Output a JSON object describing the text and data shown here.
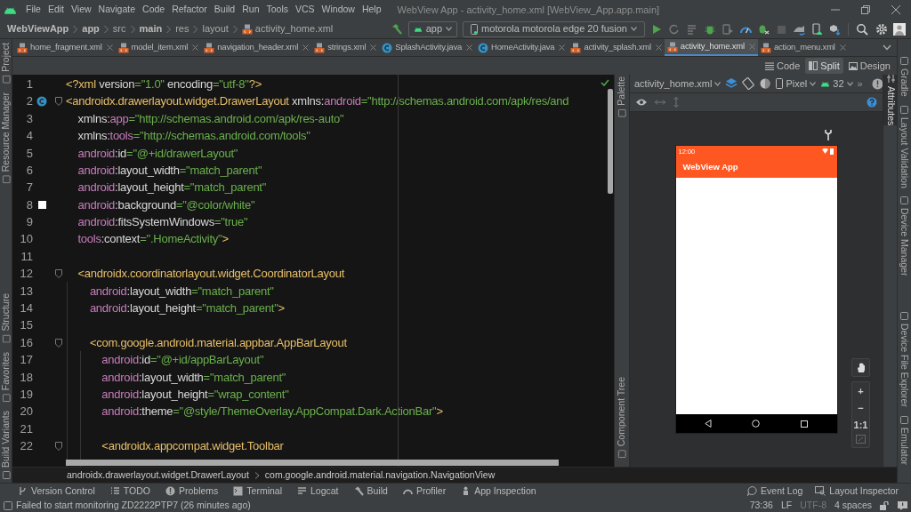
{
  "menu_bar": {
    "items": [
      "File",
      "Edit",
      "View",
      "Navigate",
      "Code",
      "Refactor",
      "Build",
      "Run",
      "Tools",
      "VCS",
      "Window",
      "Help"
    ],
    "title": "WebView App - activity_home.xml [WebView_App.app.main]"
  },
  "nav_bar": {
    "breadcrumbs": [
      {
        "label": "WebViewApp",
        "bold": true
      },
      {
        "label": "app",
        "bold": true
      },
      {
        "label": "src",
        "bold": false
      },
      {
        "label": "main",
        "bold": true
      },
      {
        "label": "res",
        "bold": false
      },
      {
        "label": "layout",
        "bold": false
      },
      {
        "label": "activity_home.xml",
        "bold": false
      }
    ],
    "run_config": "app",
    "device": "motorola motorola edge 20 fusion"
  },
  "left_tool_windows": {
    "top": [
      {
        "label": "Project"
      },
      {
        "label": "Resource Manager"
      }
    ],
    "bottom": [
      {
        "label": "Structure"
      },
      {
        "label": "Favorites"
      },
      {
        "label": "Build Variants"
      }
    ]
  },
  "right_tool_windows": {
    "top": [
      {
        "label": "Gradle"
      },
      {
        "label": "Layout Validation"
      },
      {
        "label": "Device Manager"
      }
    ],
    "bottom": [
      {
        "label": "Device File Explorer"
      },
      {
        "label": "Emulator"
      }
    ]
  },
  "editor_tabs": [
    {
      "label": "home_fragment.xml",
      "kind": "xml",
      "selected": false
    },
    {
      "label": "model_item.xml",
      "kind": "xml",
      "selected": false
    },
    {
      "label": "navigation_header.xml",
      "kind": "xml",
      "selected": false
    },
    {
      "label": "strings.xml",
      "kind": "xml",
      "selected": false
    },
    {
      "label": "SplashActivity.java",
      "kind": "class",
      "selected": false
    },
    {
      "label": "HomeActivity.java",
      "kind": "class",
      "selected": false
    },
    {
      "label": "activity_splash.xml",
      "kind": "xml",
      "selected": false
    },
    {
      "label": "activity_home.xml",
      "kind": "xml",
      "selected": true
    },
    {
      "label": "action_menu.xml",
      "kind": "xml",
      "selected": false
    }
  ],
  "view_modes": [
    {
      "label": "Code",
      "selected": false
    },
    {
      "label": "Split",
      "selected": true
    },
    {
      "label": "Design",
      "selected": false
    }
  ],
  "editor": {
    "lines": [
      {
        "number": "1",
        "fold": false,
        "kind": "plain",
        "tokens": [
          {
            "text": "<?xml",
            "kind": "tag"
          },
          {
            "text": " version",
            "kind": "attr"
          },
          {
            "text": "=\"1.0\"",
            "kind": "value"
          },
          {
            "text": " encoding",
            "kind": "attr"
          },
          {
            "text": "=\"utf-8\"",
            "kind": "value"
          },
          {
            "text": "?>",
            "kind": "tag"
          }
        ]
      },
      {
        "number": "2",
        "fold": true,
        "kind": "class-marker",
        "tokens": [
          {
            "text": "<androidx.drawerlayout.widget.DrawerLayout",
            "kind": "tag"
          },
          {
            "text": " xmlns:",
            "kind": "attr"
          },
          {
            "text": "android",
            "kind": "ns"
          },
          {
            "text": "=\"http://schemas.android.com/apk/res/and",
            "kind": "value"
          }
        ]
      },
      {
        "number": "3",
        "fold": false,
        "kind": "plain",
        "tokens": [
          {
            "text": "    xmlns:",
            "kind": "attr"
          },
          {
            "text": "app",
            "kind": "ns"
          },
          {
            "text": "=\"http://schemas.android.com/apk/res-auto\"",
            "kind": "value"
          }
        ]
      },
      {
        "number": "4",
        "fold": false,
        "kind": "plain",
        "tokens": [
          {
            "text": "    xmlns:",
            "kind": "attr"
          },
          {
            "text": "tools",
            "kind": "ns"
          },
          {
            "text": "=\"http://schemas.android.com/tools\"",
            "kind": "value"
          }
        ]
      },
      {
        "number": "5",
        "fold": false,
        "kind": "plain",
        "tokens": [
          {
            "text": "    android",
            "kind": "ns"
          },
          {
            "text": ":id",
            "kind": "attr"
          },
          {
            "text": "=\"@+id/drawerLayout\"",
            "kind": "value"
          }
        ]
      },
      {
        "number": "6",
        "fold": false,
        "kind": "plain",
        "tokens": [
          {
            "text": "    android",
            "kind": "ns"
          },
          {
            "text": ":layout_width",
            "kind": "attr"
          },
          {
            "text": "=\"match_parent\"",
            "kind": "value"
          }
        ]
      },
      {
        "number": "7",
        "fold": false,
        "kind": "plain",
        "tokens": [
          {
            "text": "    android",
            "kind": "ns"
          },
          {
            "text": ":layout_height",
            "kind": "attr"
          },
          {
            "text": "=\"match_parent\"",
            "kind": "value"
          }
        ]
      },
      {
        "number": "8",
        "fold": false,
        "kind": "color-marker",
        "tokens": [
          {
            "text": "    android",
            "kind": "ns"
          },
          {
            "text": ":background",
            "kind": "attr"
          },
          {
            "text": "=\"@color/white\"",
            "kind": "value"
          }
        ]
      },
      {
        "number": "9",
        "fold": false,
        "kind": "plain",
        "tokens": [
          {
            "text": "    android",
            "kind": "ns"
          },
          {
            "text": ":fitsSystemWindows",
            "kind": "attr"
          },
          {
            "text": "=\"true\"",
            "kind": "value"
          }
        ]
      },
      {
        "number": "10",
        "fold": false,
        "kind": "plain",
        "tokens": [
          {
            "text": "    tools",
            "kind": "ns"
          },
          {
            "text": ":context",
            "kind": "attr"
          },
          {
            "text": "=\".HomeActivity\"",
            "kind": "value"
          },
          {
            "text": ">",
            "kind": "tag"
          }
        ]
      },
      {
        "number": "11",
        "fold": false,
        "kind": "plain"
      },
      {
        "number": "12",
        "fold": true,
        "kind": "plain",
        "tokens": [
          {
            "text": "    <androidx.coordinatorlayout.widget.CoordinatorLayout",
            "kind": "tag"
          }
        ]
      },
      {
        "number": "13",
        "fold": false,
        "kind": "plain",
        "tokens": [
          {
            "text": "        android",
            "kind": "ns"
          },
          {
            "text": ":layout_width",
            "kind": "attr"
          },
          {
            "text": "=\"match_parent\"",
            "kind": "value"
          }
        ]
      },
      {
        "number": "14",
        "fold": false,
        "kind": "plain",
        "tokens": [
          {
            "text": "        android",
            "kind": "ns"
          },
          {
            "text": ":layout_height",
            "kind": "attr"
          },
          {
            "text": "=\"match_parent\"",
            "kind": "value"
          },
          {
            "text": ">",
            "kind": "tag"
          }
        ]
      },
      {
        "number": "15",
        "fold": false,
        "kind": "plain"
      },
      {
        "number": "16",
        "fold": true,
        "kind": "plain",
        "tokens": [
          {
            "text": "        <com.google.android.material.appbar.AppBarLayout",
            "kind": "tag"
          }
        ]
      },
      {
        "number": "17",
        "fold": false,
        "kind": "plain",
        "tokens": [
          {
            "text": "            android",
            "kind": "ns"
          },
          {
            "text": ":id",
            "kind": "attr"
          },
          {
            "text": "=\"@+id/appBarLayout\"",
            "kind": "value"
          }
        ]
      },
      {
        "number": "18",
        "fold": false,
        "kind": "plain",
        "tokens": [
          {
            "text": "            android",
            "kind": "ns"
          },
          {
            "text": ":layout_width",
            "kind": "attr"
          },
          {
            "text": "=\"match_parent\"",
            "kind": "value"
          }
        ]
      },
      {
        "number": "19",
        "fold": false,
        "kind": "plain",
        "tokens": [
          {
            "text": "            android",
            "kind": "ns"
          },
          {
            "text": ":layout_height",
            "kind": "attr"
          },
          {
            "text": "=\"wrap_content\"",
            "kind": "value"
          }
        ]
      },
      {
        "number": "20",
        "fold": false,
        "kind": "plain",
        "tokens": [
          {
            "text": "            android",
            "kind": "ns"
          },
          {
            "text": ":theme",
            "kind": "attr"
          },
          {
            "text": "=\"@style/ThemeOverlay.AppCompat.Dark.ActionBar\"",
            "kind": "value"
          },
          {
            "text": ">",
            "kind": "tag"
          }
        ]
      },
      {
        "number": "21",
        "fold": false,
        "kind": "plain"
      },
      {
        "number": "22",
        "fold": true,
        "kind": "plain",
        "tokens": [
          {
            "text": "            <androidx.appcompat.widget.Toolbar",
            "kind": "tag"
          }
        ]
      }
    ]
  },
  "editor_breadcrumb": [
    "androidx.drawerlayout.widget.DrawerLayout",
    "com.google.android.material.navigation.NavigationView"
  ],
  "design": {
    "layout_file": "activity_home.xml",
    "device": "Pixel",
    "api_level": "32",
    "overflow": "»",
    "side_tabs": {
      "top": [
        {
          "label": "Palette"
        }
      ],
      "bottom": [
        {
          "label": "Component Tree"
        }
      ]
    },
    "attributes_tab": {
      "label": "Attributes",
      "selected": true
    },
    "preview": {
      "time": "12:00",
      "app_title": "WebView App"
    },
    "zoom": [
      "+",
      "−",
      "1:1"
    ]
  },
  "bottom_tools": [
    {
      "label": "Version Control"
    },
    {
      "label": "TODO"
    },
    {
      "label": "Problems"
    },
    {
      "label": "Terminal"
    },
    {
      "label": "Logcat"
    },
    {
      "label": "Build"
    },
    {
      "label": "Profiler"
    },
    {
      "label": "App Inspection"
    }
  ],
  "bottom_tools_right": [
    {
      "label": "Event Log"
    },
    {
      "label": "Layout Inspector"
    }
  ],
  "status_bar": {
    "message": "Failed to start monitoring ZD2222PTP7 (26 minutes ago)",
    "items": [
      {
        "text": "73:36",
        "dimmed": false
      },
      {
        "text": "LF",
        "dimmed": false
      },
      {
        "text": "UTF-8",
        "dimmed": true
      },
      {
        "text": "4 spaces",
        "dimmed": false
      }
    ]
  }
}
